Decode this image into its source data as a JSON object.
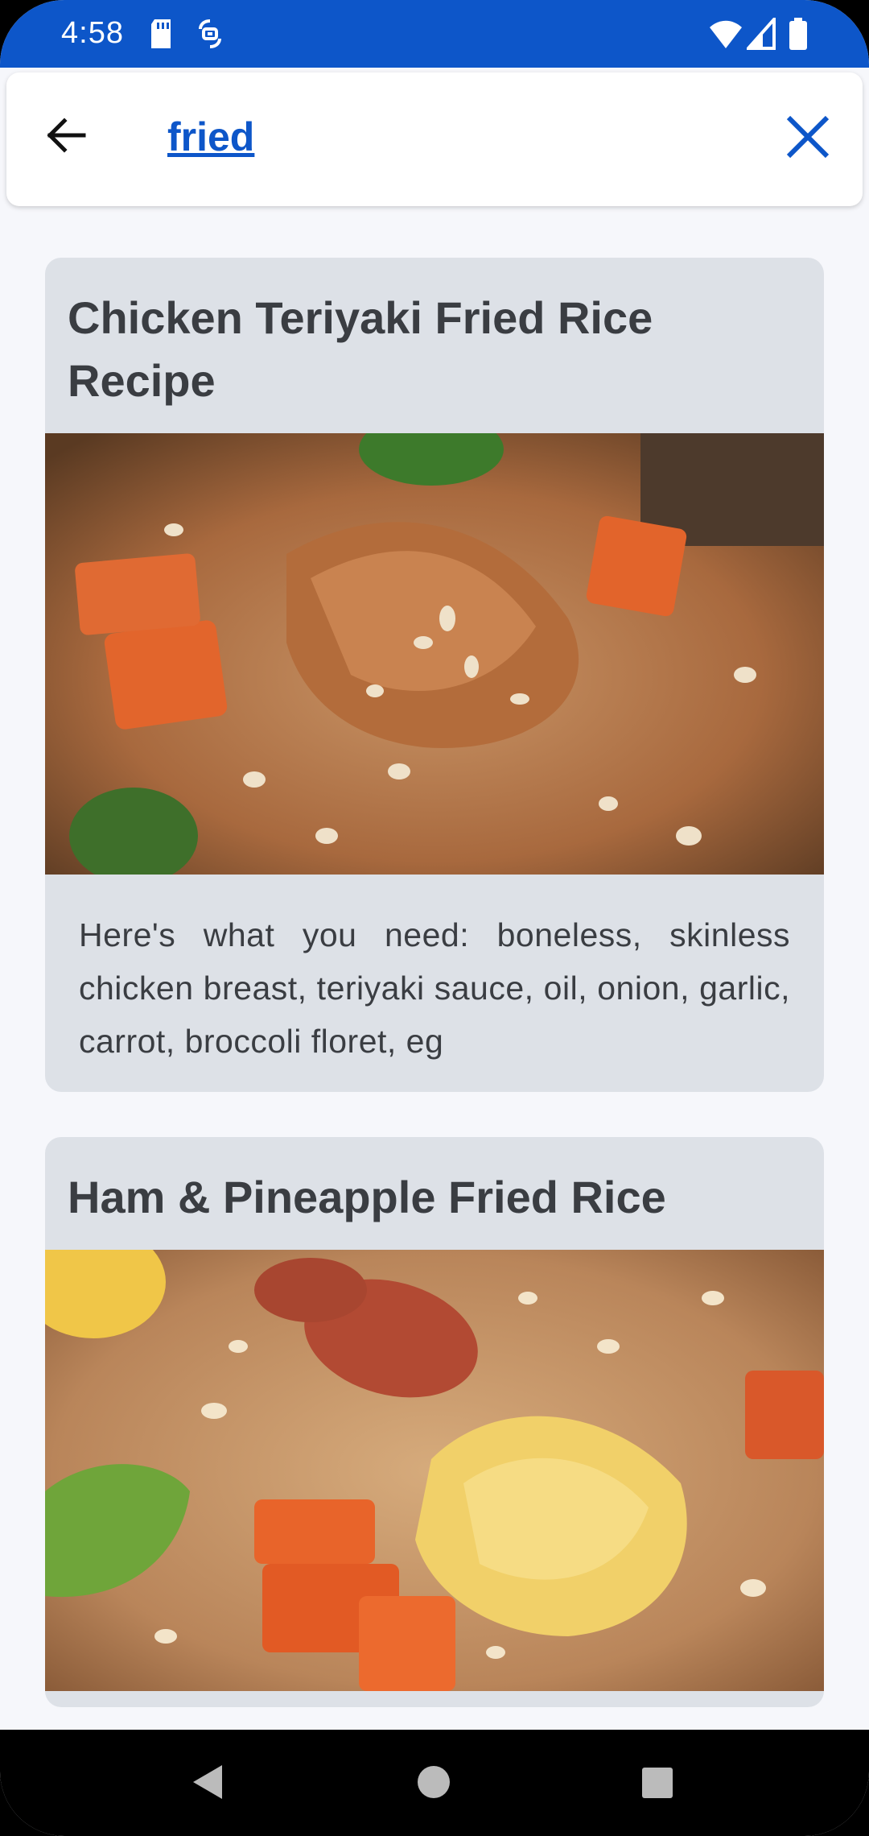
{
  "status_bar": {
    "time": "4:58",
    "icons": [
      "sd-card-icon",
      "signal-sync-icon",
      "wifi-icon",
      "cellular-icon",
      "battery-icon"
    ]
  },
  "search": {
    "query": "fried",
    "back_icon": "arrow-left-icon",
    "clear_icon": "close-icon"
  },
  "results": [
    {
      "title": "Chicken Teriyaki Fried Rice Recipe",
      "image": "chicken-teriyaki-fried-rice-photo",
      "description": "Here's what you need: boneless, skinless chicken breast, teriyaki sauce, oil, onion, garlic, carrot, broccoli floret, eg"
    },
    {
      "title": "Ham & Pineapple Fried Rice",
      "image": "ham-pineapple-fried-rice-photo",
      "description": ""
    }
  ],
  "nav": {
    "back": "nav-back-icon",
    "home": "nav-home-icon",
    "recents": "nav-recents-icon"
  },
  "colors": {
    "accent": "#0d56c9",
    "card_bg": "#dde1e7",
    "page_bg": "#f6f7fb",
    "title_text": "#3a3d42"
  }
}
